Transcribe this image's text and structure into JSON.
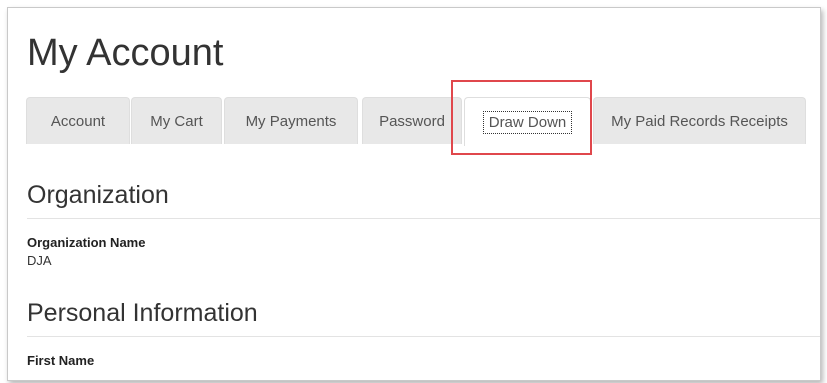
{
  "page": {
    "title": "My Account"
  },
  "tabs": [
    {
      "label": "Account"
    },
    {
      "label": "My Cart"
    },
    {
      "label": "My Payments"
    },
    {
      "label": "Password"
    },
    {
      "label": "Draw Down",
      "active": true
    },
    {
      "label": "My Paid Records Receipts"
    }
  ],
  "sections": {
    "organization": {
      "title": "Organization",
      "fields": [
        {
          "label": "Organization Name",
          "value": "DJA"
        }
      ]
    },
    "personal": {
      "title": "Personal Information",
      "fields": [
        {
          "label": "First Name",
          "value": ""
        }
      ]
    }
  },
  "colors": {
    "highlight": "#e0474c",
    "tab_bg": "#e8e8e8",
    "active_tab_bg": "#ffffff"
  }
}
